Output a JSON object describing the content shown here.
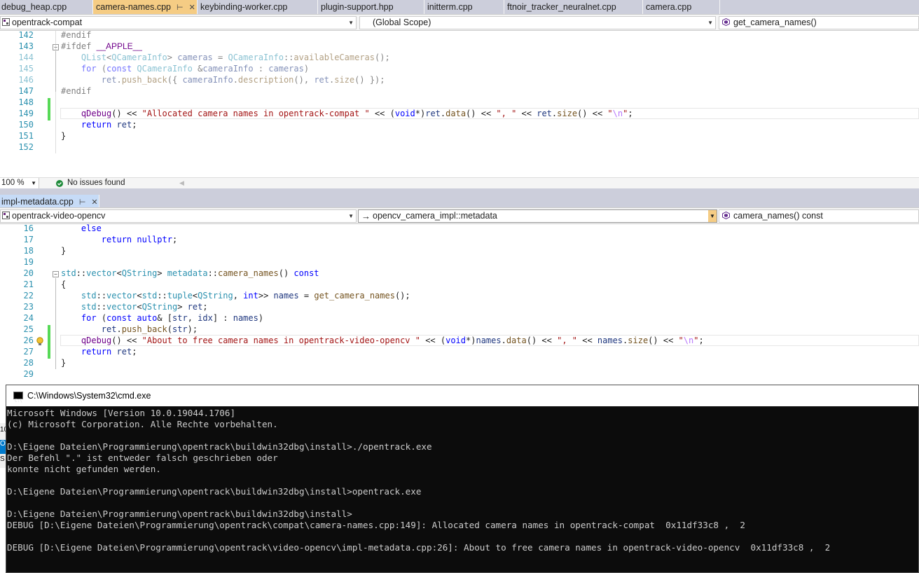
{
  "top_tabs": [
    {
      "label": "debug_heap.cpp",
      "active": false
    },
    {
      "label": "camera-names.cpp",
      "active": true
    },
    {
      "label": "keybinding-worker.cpp",
      "active": false
    },
    {
      "label": "plugin-support.hpp",
      "active": false
    },
    {
      "label": "initterm.cpp",
      "active": false
    },
    {
      "label": "ftnoir_tracker_neuralnet.cpp",
      "active": false
    },
    {
      "label": "camera.cpp",
      "active": false
    }
  ],
  "top_nav": {
    "project": "opentrack-compat",
    "scope": "(Global Scope)",
    "member": "get_camera_names()"
  },
  "top_editor": {
    "line_numbers": [
      "142",
      "143",
      "144",
      "145",
      "146",
      "147",
      "148",
      "149",
      "150",
      "151",
      "152"
    ]
  },
  "top_status": {
    "zoom": "100 %",
    "issues": "No issues found"
  },
  "bottom_tab": {
    "label": "impl-metadata.cpp"
  },
  "bottom_nav": {
    "project": "opentrack-video-opencv",
    "scope": "opencv_camera_impl::metadata",
    "member": "camera_names() const"
  },
  "bottom_editor": {
    "line_numbers": [
      "16",
      "17",
      "18",
      "19",
      "20",
      "21",
      "22",
      "23",
      "24",
      "25",
      "26",
      "27",
      "28",
      "29"
    ]
  },
  "console": {
    "title": "C:\\Windows\\System32\\cmd.exe",
    "lines": [
      "Microsoft Windows [Version 10.0.19044.1706]",
      "(c) Microsoft Corporation. Alle Rechte vorbehalten.",
      "",
      "D:\\Eigene Dateien\\Programmierung\\opentrack\\buildwin32dbg\\install>./opentrack.exe",
      "Der Befehl \".\" ist entweder falsch geschrieben oder",
      "konnte nicht gefunden werden.",
      "",
      "D:\\Eigene Dateien\\Programmierung\\opentrack\\buildwin32dbg\\install>opentrack.exe",
      "",
      "D:\\Eigene Dateien\\Programmierung\\opentrack\\buildwin32dbg\\install>",
      "DEBUG [D:\\Eigene Dateien\\Programmierung\\opentrack\\compat\\camera-names.cpp:149]: Allocated camera names in opentrack-compat  0x11df33c8 ,  2",
      "",
      "DEBUG [D:\\Eigene Dateien\\Programmierung\\opentrack\\video-opencv\\impl-metadata.cpp:26]: About to free camera names in opentrack-video-opencv  0x11df33c8 ,  2"
    ]
  },
  "left_side_text": [
    "10",
    "O",
    "S"
  ]
}
